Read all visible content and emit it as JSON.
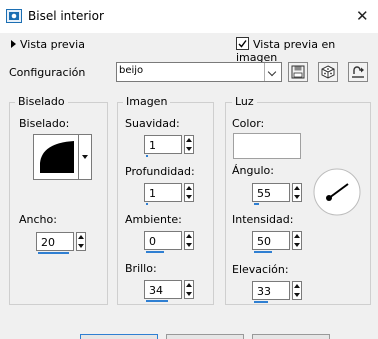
{
  "window": {
    "title": "Bisel interior"
  },
  "header": {
    "preview_label": "Vista previa",
    "live_preview_label": "Vista previa en imagen",
    "live_preview_checked": true
  },
  "config": {
    "label": "Configuración",
    "value": "beijo"
  },
  "groups": {
    "bevel": {
      "title": "Biselado",
      "bevel_label": "Biselado:",
      "width_label": "Ancho:",
      "width_value": "20"
    },
    "image": {
      "title": "Imagen",
      "smoothness_label": "Suavidad:",
      "smoothness_value": "1",
      "depth_label": "Profundidad:",
      "depth_value": "1",
      "ambient_label": "Ambiente:",
      "ambient_value": "0",
      "brightness_label": "Brillo:",
      "brightness_value": "34"
    },
    "light": {
      "title": "Luz",
      "color_label": "Color:",
      "color_value": "#ffffff",
      "angle_label": "Ángulo:",
      "angle_value": "55",
      "intensity_label": "Intensidad:",
      "intensity_value": "50",
      "elevation_label": "Elevación:",
      "elevation_value": "33"
    }
  },
  "colors": {
    "accent": "#2f7fd2",
    "title_icon": "#1c6fb3"
  },
  "icons": [
    "app-icon",
    "close-icon",
    "save-icon",
    "randomize-icon",
    "reset-icon",
    "chevron-down-icon",
    "bevel-shape-icon",
    "angle-dial-icon"
  ]
}
